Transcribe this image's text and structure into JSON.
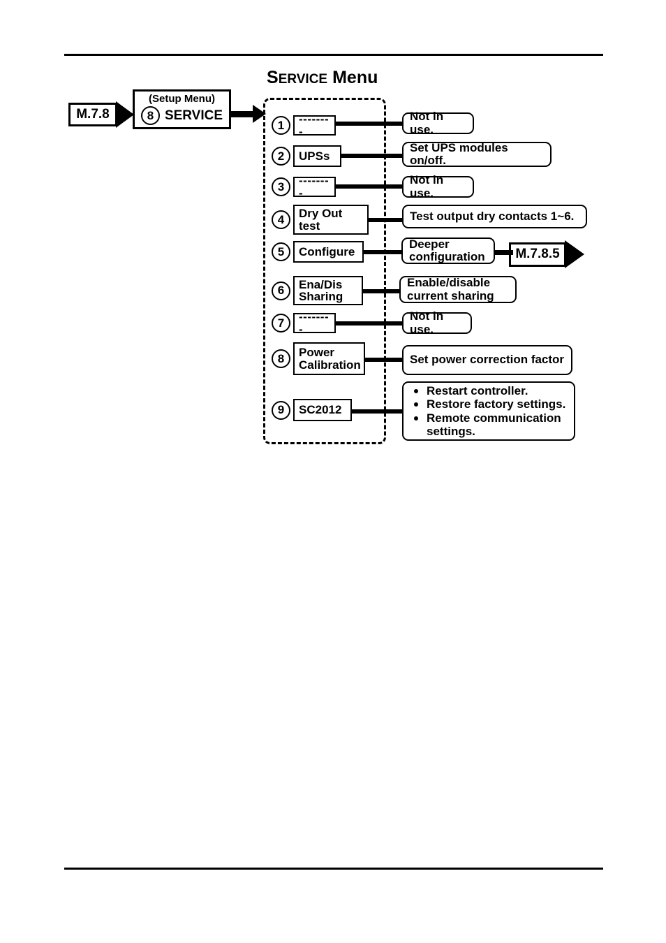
{
  "page": {
    "title": "SERVICE Menu",
    "title_parts": {
      "lead": "S",
      "smallcaps": "ERVICE",
      "word2": "Menu"
    }
  },
  "entry": {
    "tag_label": "M.7.8",
    "source_box": {
      "caption": "(Setup Menu)",
      "number": "8",
      "label": "SERVICE"
    }
  },
  "menu": {
    "items": [
      {
        "number": "1",
        "label": "--------",
        "description": "Not in use."
      },
      {
        "number": "2",
        "label": "UPSs",
        "description": "Set UPS modules on/off."
      },
      {
        "number": "3",
        "label": "--------",
        "description": "Not in use."
      },
      {
        "number": "4",
        "label": "Dry Out\ntest",
        "description": "Test output dry contacts 1~6."
      },
      {
        "number": "5",
        "label": "Configure",
        "description": "Deeper\nconfiguration",
        "link_tag": "M.7.8.5"
      },
      {
        "number": "6",
        "label": "Ena/Dis\nSharing",
        "description": "Enable/disable\ncurrent sharing"
      },
      {
        "number": "7",
        "label": "--------",
        "description": "Not in use."
      },
      {
        "number": "8",
        "label": "Power\nCalibration",
        "description": "Set power correction factor"
      },
      {
        "number": "9",
        "label": "SC2012",
        "description": null,
        "bullets": [
          "Restart controller.",
          "Restore factory settings.",
          "Remote communication settings."
        ]
      }
    ]
  },
  "colors": {
    "ink": "#000000",
    "paper": "#ffffff"
  }
}
